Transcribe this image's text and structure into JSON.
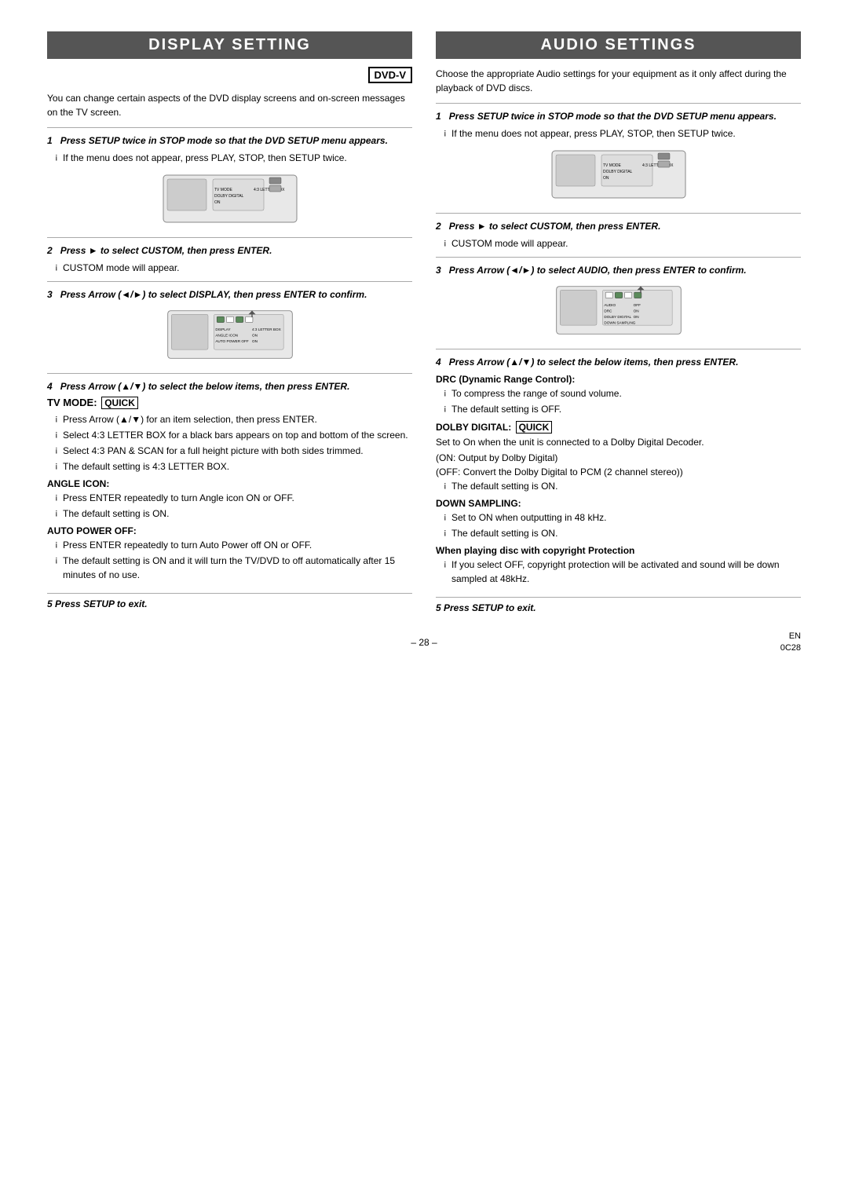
{
  "left_section": {
    "title": "Display Setting",
    "dvd_badge": "DVD-V",
    "intro": "You can change certain aspects of the DVD display screens and on-screen messages on the TV screen.",
    "step1": {
      "number": "1",
      "header": "Press SETUP twice in STOP mode so that the DVD SETUP menu appears.",
      "bullet1": "If the menu does not appear, press PLAY, STOP, then SETUP twice."
    },
    "step2": {
      "number": "2",
      "header": "Press ► to select CUSTOM, then press ENTER.",
      "bullet1": "CUSTOM mode will appear."
    },
    "step3": {
      "number": "3",
      "header": "Press Arrow (◄/►) to select DISPLAY, then press ENTER to confirm."
    },
    "step4": {
      "number": "4",
      "header": "Press Arrow (▲/▼) to select the below items, then press ENTER.",
      "tv_mode_label": "TV MODE:",
      "tv_mode_quick": "QUICK",
      "tv_mode_bullets": [
        "Press Arrow (▲/▼) for an item selection, then press ENTER.",
        "Select 4:3 LETTER BOX for a black bars appears on top and bottom of the screen.",
        "Select 4:3 PAN & SCAN for a full height picture with both sides trimmed.",
        "The default setting is 4:3 LETTER BOX."
      ],
      "angle_icon_title": "ANGLE ICON:",
      "angle_icon_bullets": [
        "Press ENTER repeatedly to turn Angle icon ON or OFF.",
        "The default setting is ON."
      ],
      "auto_power_title": "AUTO POWER OFF:",
      "auto_power_bullets": [
        "Press ENTER repeatedly to turn Auto Power off ON or OFF.",
        "The default setting is ON and it will turn the TV/DVD to off automatically after 15 minutes of no use."
      ]
    },
    "step5": "5    Press SETUP to exit."
  },
  "right_section": {
    "title": "Audio Settings",
    "intro": "Choose the appropriate Audio settings for your equipment as it only affect during the playback of DVD discs.",
    "step1": {
      "number": "1",
      "header": "Press SETUP twice in STOP mode so that the DVD SETUP menu appears.",
      "bullet1": "If the menu does not appear, press PLAY, STOP, then SETUP twice."
    },
    "step2": {
      "number": "2",
      "header": "Press ► to select CUSTOM, then press ENTER.",
      "bullet1": "CUSTOM mode will appear."
    },
    "step3": {
      "number": "3",
      "header": "Press Arrow (◄/►) to select AUDIO, then press ENTER to confirm."
    },
    "step4": {
      "number": "4",
      "header": "Press Arrow (▲/▼) to select the below items, then press ENTER.",
      "drc_title": "DRC (Dynamic Range Control):",
      "drc_bullets": [
        "To compress the range of sound volume.",
        "The default setting is OFF."
      ],
      "dolby_title": "DOLBY DIGITAL:",
      "dolby_quick": "QUICK",
      "dolby_intro": "Set to On when the unit is connected to a Dolby Digital Decoder.",
      "dolby_lines": [
        "(ON: Output by Dolby Digital)",
        "(OFF: Convert the Dolby Digital to PCM (2 channel stereo))",
        "The default setting is ON."
      ],
      "down_title": "DOWN SAMPLING:",
      "down_bullets": [
        "Set to ON when outputting in 48 kHz.",
        "The default setting is ON."
      ],
      "copyright_title": "When playing disc with copyright Protection",
      "copyright_bullet": "If you select OFF, copyright protection will be activated and sound will be down sampled at 48kHz."
    },
    "step5": "5    Press SETUP to exit."
  },
  "footer": {
    "page_number": "– 28 –",
    "lang": "EN",
    "code": "0C28"
  }
}
